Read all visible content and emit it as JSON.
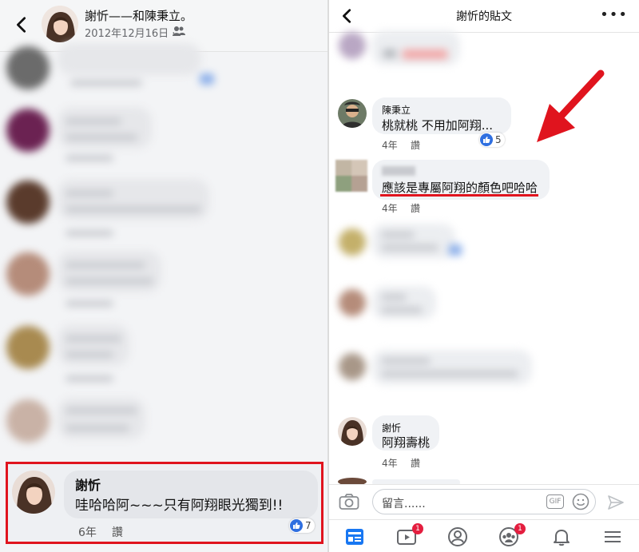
{
  "left": {
    "header": {
      "title": "謝忻——和陳秉立。",
      "subtitle": "2012年12月16日 ·"
    },
    "highlighted_comment": {
      "author": "謝忻",
      "text": "哇哈哈阿~~~只有阿翔眼光獨到!!",
      "time": "6年",
      "like_action": "讚",
      "reaction_count": "7"
    }
  },
  "right": {
    "header": {
      "title": "謝忻的貼文",
      "menu": "•••"
    },
    "comments": [
      {
        "author": "陳秉立",
        "text": "桃就桃 不用加阿翔...",
        "time": "4年",
        "like_action": "讚",
        "reaction_count": "5"
      },
      {
        "author": "",
        "text": "應該是專屬阿翔的顏色吧哈哈",
        "time": "4年",
        "like_action": "讚"
      },
      {
        "author": "謝忻",
        "text": "阿翔壽桃",
        "time": "4年",
        "like_action": "讚"
      }
    ],
    "composer": {
      "placeholder": "留言......",
      "gif_label": "GIF"
    },
    "tabbar": {
      "watch_badge": "1",
      "groups_badge": "1"
    }
  },
  "colors": {
    "highlight_red": "#e0141e",
    "like_blue": "#2f6fe0",
    "badge_red": "#e41e3f",
    "active_tab": "#1877f2"
  }
}
